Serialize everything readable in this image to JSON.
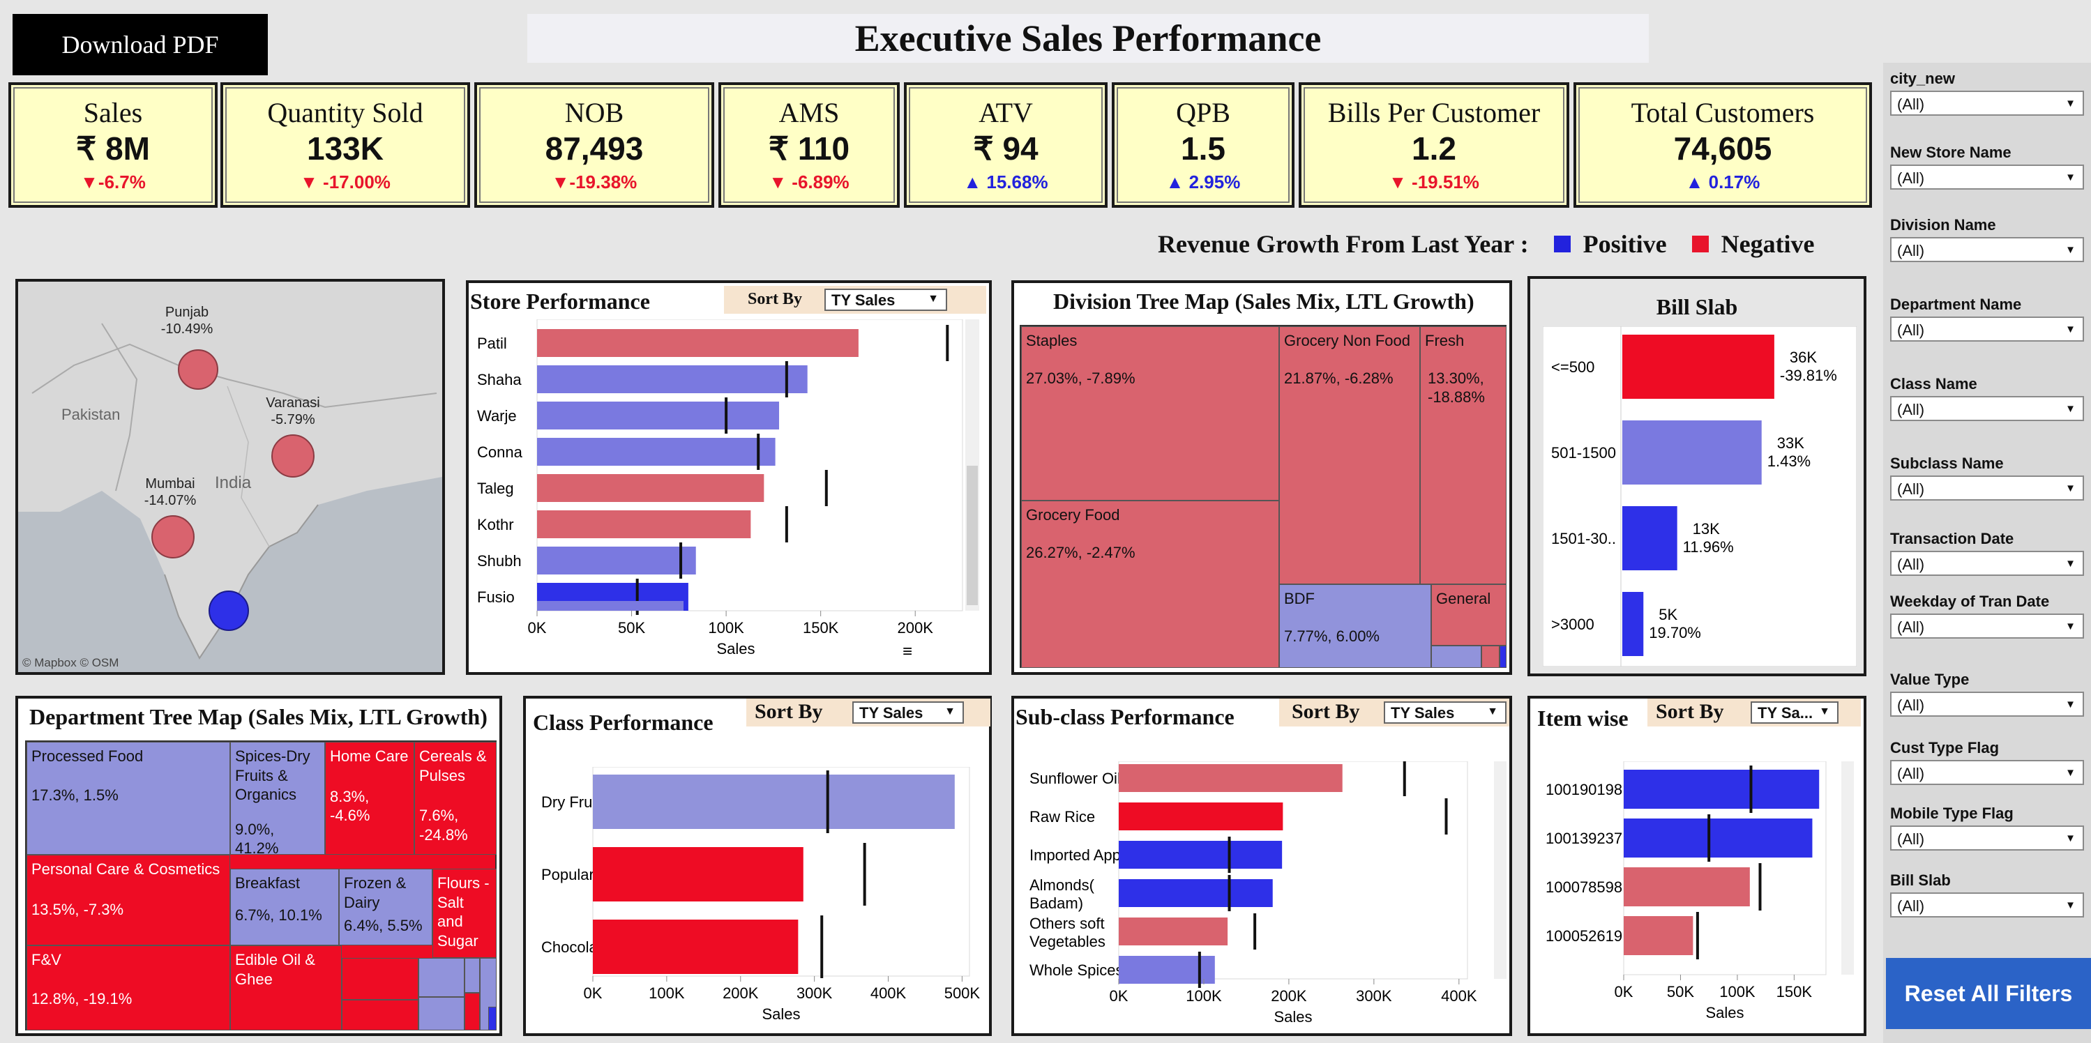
{
  "header": {
    "download_label": "Download PDF",
    "title": "Executive Sales Performance"
  },
  "kpis": [
    {
      "title": "Sales",
      "value": "₹ 8M",
      "delta": "▼-6.7%",
      "trend": "negative"
    },
    {
      "title": "Quantity Sold",
      "value": "133K",
      "delta": "▼ -17.00%",
      "trend": "negative"
    },
    {
      "title": "NOB",
      "value": "87,493",
      "delta": "▼-19.38%",
      "trend": "negative"
    },
    {
      "title": "AMS",
      "value": "₹ 110",
      "delta": "▼ -6.89%",
      "trend": "negative"
    },
    {
      "title": "ATV",
      "value": "₹ 94",
      "delta": "▲ 15.68%",
      "trend": "positive"
    },
    {
      "title": "QPB",
      "value": "1.5",
      "delta": "▲ 2.95%",
      "trend": "positive"
    },
    {
      "title": "Bills Per Customer",
      "value": "1.2",
      "delta": "▼ -19.51%",
      "trend": "negative"
    },
    {
      "title": "Total Customers",
      "value": "74,605",
      "delta": "▲ 0.17%",
      "trend": "positive"
    }
  ],
  "legend": {
    "label": "Revenue Growth From Last Year :",
    "positive": "Positive",
    "negative": "Negative",
    "positive_color": "#2222dd",
    "negative_color": "#e8142b"
  },
  "map": {
    "country_labels": [
      "Pakistan",
      "India"
    ],
    "cities": [
      {
        "name": "Punjab",
        "growth": "-10.49%"
      },
      {
        "name": "Varanasi",
        "growth": "-5.79%"
      },
      {
        "name": "Mumbai",
        "growth": "-14.07%"
      },
      {
        "name": "",
        "growth": ""
      }
    ],
    "attribution": "© Mapbox  © OSM"
  },
  "sort": {
    "label": "Sort By",
    "value": "TY Sales",
    "value_short": "TY Sa..."
  },
  "store_performance": {
    "title": "Store Performance",
    "chart_data": {
      "type": "bar",
      "orientation": "horizontal",
      "categories": [
        "Patil",
        "Shaha",
        "Warje",
        "Conna",
        "Taleg",
        "Kothr",
        "Shubh",
        "Fusio"
      ],
      "values": [
        170000,
        143000,
        128000,
        126000,
        120000,
        113000,
        84000,
        80000
      ],
      "reference": [
        217000,
        132000,
        100000,
        117000,
        153000,
        132000,
        76000,
        53000
      ],
      "colors": [
        "#d9636e",
        "#7a79e0",
        "#7a79e0",
        "#7a79e0",
        "#d9636e",
        "#d9636e",
        "#7a79e0",
        "#2e30e8"
      ],
      "ticks": [
        "0K",
        "50K",
        "100K",
        "150K",
        "200K"
      ],
      "xlim": [
        0,
        225000
      ],
      "xlabel": "Sales"
    }
  },
  "division_tree": {
    "title": "Division Tree Map (Sales Mix, LTL Growth)",
    "tiles": [
      {
        "name": "Staples",
        "value": "27.03%,  -7.89%"
      },
      {
        "name": "Grocery Food",
        "value": "26.27%,  -2.47%"
      },
      {
        "name": "Grocery Non Food",
        "value": "21.87%,  -6.28%"
      },
      {
        "name": "Fresh",
        "value": "13.30%, -18.88%"
      },
      {
        "name": "BDF",
        "value": "7.77%,  6.00%"
      },
      {
        "name": "General",
        "value": ""
      }
    ]
  },
  "bill_slab": {
    "title": "Bill Slab",
    "chart_data": {
      "type": "bar",
      "orientation": "horizontal",
      "categories": [
        "<=500",
        "501-1500",
        "1501-30..",
        ">3000"
      ],
      "values": [
        36000,
        33000,
        13000,
        5000
      ],
      "labels": [
        "36K",
        "33K",
        "13K",
        "5K"
      ],
      "growth": [
        "-39.81%",
        "1.43%",
        "11.96%",
        "19.70%"
      ],
      "colors": [
        "#ee0c24",
        "#7a79e0",
        "#2e30e8",
        "#2e30e8"
      ],
      "xlim": [
        0,
        38000
      ]
    }
  },
  "department_tree": {
    "title": "Department Tree Map (Sales Mix, LTL Growth)",
    "tiles": [
      {
        "name": "Processed Food",
        "value": "17.3%, 1.5%"
      },
      {
        "name": "Spices-Dry Fruits & Organics",
        "value": "9.0%, 41.2%"
      },
      {
        "name": "Home Care",
        "value": "8.3%, -4.6%"
      },
      {
        "name": "Cereals & Pulses",
        "value": "7.6%, -24.8%"
      },
      {
        "name": "Personal Care & Cosmetics",
        "value": "13.5%, -7.3%"
      },
      {
        "name": "Breakfast",
        "value": "6.7%, 10.1%"
      },
      {
        "name": "Frozen & Dairy",
        "value": "6.4%, 5.5%"
      },
      {
        "name": "Flours - Salt and Sugar",
        "value": ""
      },
      {
        "name": "F&V",
        "value": "12.8%, -19.1%"
      },
      {
        "name": "Edible Oil & Ghee",
        "value": ""
      }
    ]
  },
  "class_performance": {
    "title": "Class Performance",
    "chart_data": {
      "type": "bar",
      "orientation": "horizontal",
      "categories": [
        "Dry Fruits",
        "Popular Oil",
        "Chocolate"
      ],
      "values": [
        490000,
        285000,
        278000
      ],
      "reference": [
        318000,
        368000,
        310000
      ],
      "colors": [
        "#9193db",
        "#ee0c24",
        "#ee0c24"
      ],
      "ticks": [
        "0K",
        "100K",
        "200K",
        "300K",
        "400K",
        "500K"
      ],
      "xlim": [
        0,
        510000
      ],
      "xlabel": "Sales"
    }
  },
  "subclass_performance": {
    "title": "Sub-class Performance",
    "chart_data": {
      "type": "bar",
      "orientation": "horizontal",
      "categories": [
        "Sunflower Oil",
        "Raw Rice",
        "Imported Apple",
        "Almonds( Badam)",
        "Others soft Vegetables",
        "Whole Spices"
      ],
      "values": [
        263000,
        193000,
        192000,
        181000,
        128000,
        113000
      ],
      "reference": [
        336000,
        385000,
        130000,
        130000,
        160000,
        95000
      ],
      "colors": [
        "#d9636e",
        "#ee0c24",
        "#2e30e8",
        "#2e30e8",
        "#d9636e",
        "#7a79e0"
      ],
      "ticks": [
        "0K",
        "100K",
        "200K",
        "300K",
        "400K"
      ],
      "xlim": [
        0,
        410000
      ],
      "xlabel": "Sales"
    }
  },
  "item_wise": {
    "title": "Item wise",
    "chart_data": {
      "type": "bar",
      "orientation": "horizontal",
      "categories": [
        "100190198",
        "100139237",
        "100078598",
        "100052619"
      ],
      "values": [
        172000,
        166000,
        111000,
        61000
      ],
      "reference": [
        112000,
        75000,
        120000,
        65000
      ],
      "colors": [
        "#2e30e8",
        "#2e30e8",
        "#d9636e",
        "#d9636e"
      ],
      "ticks": [
        "0K",
        "50K",
        "100K",
        "150K"
      ],
      "xlim": [
        0,
        178000
      ],
      "xlabel": "Sales"
    }
  },
  "filters": [
    {
      "label": "city_new",
      "value": "(All)"
    },
    {
      "label": "New Store Name",
      "value": "(All)"
    },
    {
      "label": "Division Name",
      "value": "(All)"
    },
    {
      "label": "Department Name",
      "value": "(All)"
    },
    {
      "label": "Class Name",
      "value": "(All)"
    },
    {
      "label": "Subclass Name",
      "value": "(All)"
    },
    {
      "label": "Transaction Date",
      "value": "(All)"
    },
    {
      "label": "Weekday of Tran Date",
      "value": "(All)"
    },
    {
      "label": "Value Type",
      "value": "(All)"
    },
    {
      "label": "Cust Type Flag",
      "value": "(All)"
    },
    {
      "label": "Mobile Type Flag",
      "value": "(All)"
    },
    {
      "label": "Bill Slab",
      "value": "(All)"
    }
  ],
  "reset_label": "Reset All Filters"
}
